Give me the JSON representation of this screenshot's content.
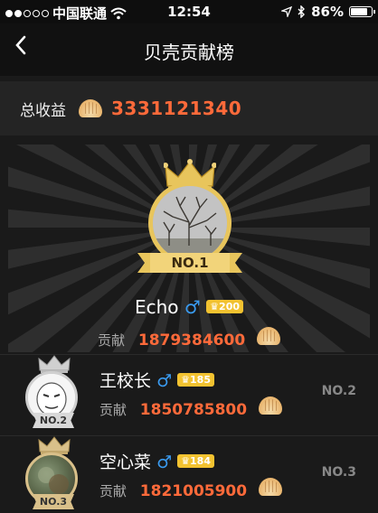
{
  "status": {
    "carrier": "中国联通",
    "time": "12:54",
    "battery": "86%",
    "battery_level": 0.86
  },
  "nav": {
    "back_glyph": "<",
    "title": "贝壳贡献榜"
  },
  "income": {
    "label": "总收益",
    "value": "3331121340",
    "icon": "shell-icon"
  },
  "top1": {
    "rank_label": "NO.1",
    "name": "Echo",
    "gender": "♂",
    "level": "200",
    "contrib_label": "贡献",
    "contrib_value": "1879384600"
  },
  "list": [
    {
      "rank_label": "NO.2",
      "rank_right": "NO.2",
      "name": "王校长",
      "gender": "♂",
      "level": "185",
      "contrib_label": "贡献",
      "contrib_value": "1850785800"
    },
    {
      "rank_label": "NO.3",
      "rank_right": "NO.3",
      "name": "空心菜",
      "gender": "♂",
      "level": "184",
      "contrib_label": "贡献",
      "contrib_value": "1821005900"
    }
  ],
  "colors": {
    "accent_orange": "#ff6a3a",
    "gold": "#e8c55c",
    "male_blue": "#3a9bf0",
    "level_badge": "#f2c230"
  }
}
